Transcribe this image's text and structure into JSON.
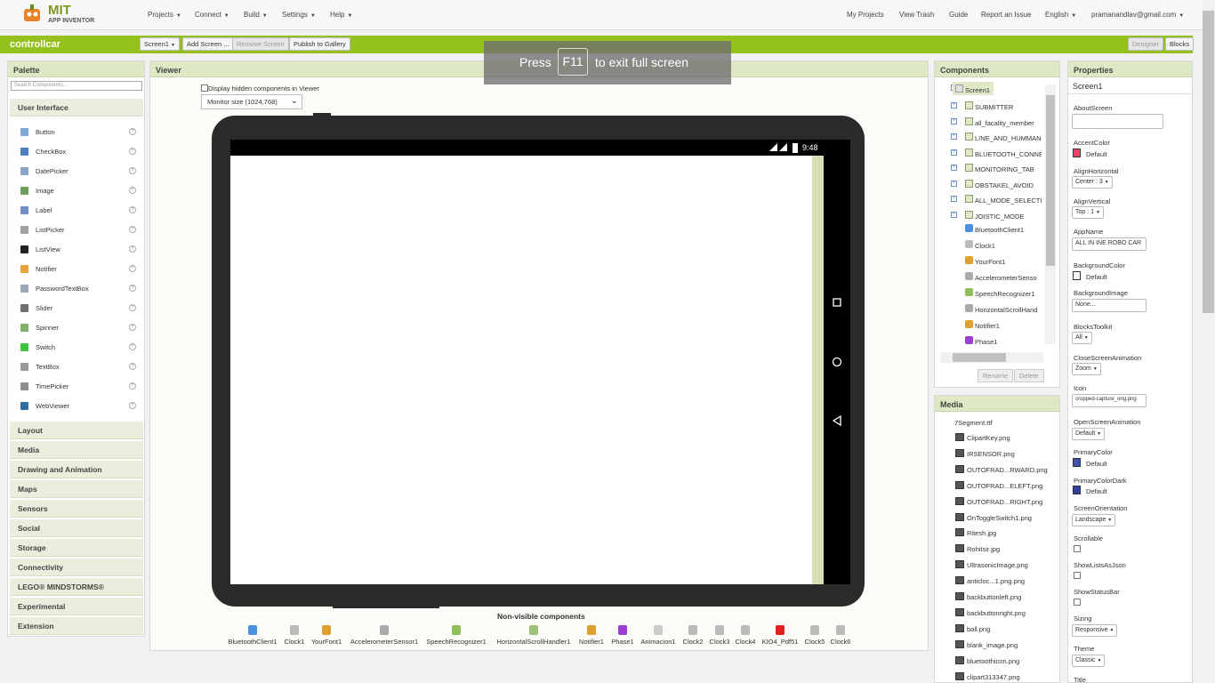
{
  "nav": {
    "logo_mit": "MIT",
    "logo_ai": "APP INVENTOR",
    "menus": [
      "Projects",
      "Connect",
      "Build",
      "Settings",
      "Help"
    ],
    "right_links": [
      "My Projects",
      "View Trash",
      "Guide",
      "Report an Issue"
    ],
    "language": "English",
    "account": "pramanandlav@gmail.com"
  },
  "project_bar": {
    "title": "controllcar",
    "screen_select": "Screen1",
    "add_screen": "Add Screen ...",
    "remove_screen": "Remove Screen",
    "publish": "Publish to Gallery",
    "designer": "Designer",
    "blocks": "Blocks"
  },
  "fullscreen_hint": {
    "press": "Press",
    "key": "F11",
    "rest": "to exit full screen"
  },
  "palette": {
    "title": "Palette",
    "search_placeholder": "Search Components...",
    "open_category": "User Interface",
    "items": [
      "Button",
      "CheckBox",
      "DatePicker",
      "Image",
      "Label",
      "ListPicker",
      "ListView",
      "Notifier",
      "PasswordTextBox",
      "Slider",
      "Spinner",
      "Switch",
      "TextBox",
      "TimePicker",
      "WebViewer"
    ],
    "categories": [
      "Layout",
      "Media",
      "Drawing and Animation",
      "Maps",
      "Sensors",
      "Social",
      "Storage",
      "Connectivity",
      "LEGO® MINDSTORMS®",
      "Experimental",
      "Extension"
    ]
  },
  "viewer": {
    "title": "Viewer",
    "hidden_label": "Display hidden components in Viewer",
    "size_select": "Monitor size (1024,768)",
    "status_time": "9:48",
    "nonvisible_title": "Non-visible components",
    "nonvisible": [
      "BluetoothClient1",
      "Clock1",
      "YourFont1",
      "AccelerometerSensor1",
      "SpeechRecognizer1",
      "HorizontalScrollHandler1",
      "Notifier1",
      "Phase1",
      "Animacion1",
      "Clock2",
      "Clock3",
      "Clock4",
      "KIO4_Pdf51",
      "Clock5",
      "Clock6"
    ]
  },
  "components": {
    "title": "Components",
    "root": "Screen1",
    "arrangements": [
      "SUBMITTER",
      "all_facality_member",
      "LINE_AND_HUMMAN",
      "BLUETOOTH_CONNE",
      "MONITORING_TAB",
      "OBSTAKEL_AVOID",
      "ALL_MODE_SELECTI",
      "JOISTIC_MODE"
    ],
    "others": [
      "BluetoothClient1",
      "Clock1",
      "YourFont1",
      "AccelerometerSenso",
      "SpeechRecognizer1",
      "HorizontalScrollHand",
      "Notifier1",
      "Phase1"
    ],
    "rename": "Rename",
    "delete": "Delete"
  },
  "media": {
    "title": "Media",
    "font_file": "7Segment.ttf",
    "files": [
      "ClipartKey.png",
      "IRSENSOR.png",
      "OUTOFRAD...RWARD.png",
      "OUTOFRAD...ELEFT.png",
      "OUTOFRAD...RIGHT.png",
      "OnToggleSwitch1.png",
      "Ritesh.jpg",
      "Rohitsir.jpg",
      "UltrasonicImage.png",
      "anticloc...1.png.png",
      "backbuttonleft.png",
      "backbuttonright.png",
      "ball.png",
      "blank_image.png",
      "bluetoothicon.png",
      "clipart313347.png"
    ]
  },
  "properties": {
    "title": "Properties",
    "component": "Screen1",
    "about_label": "AboutScreen",
    "accent_label": "AccentColor",
    "accent_value": "Default",
    "accent_color": "#e8456b",
    "alignh_label": "AlignHorizontal",
    "alignh_value": "Center : 3",
    "alignv_label": "AlignVertical",
    "alignv_value": "Top : 1",
    "appname_label": "AppName",
    "appname_value": "ALL IN INE ROBO CAR",
    "bg_label": "BackgroundColor",
    "bg_value": "Default",
    "bg_color": "#ffffff",
    "bgimg_label": "BackgroundImage",
    "bgimg_value": "None...",
    "toolkit_label": "BlocksToolkit",
    "toolkit_value": "All",
    "close_anim_label": "CloseScreenAnimation",
    "close_anim_value": "Zoom",
    "icon_label": "Icon",
    "icon_value": "cropped-capture_orig.png",
    "open_anim_label": "OpenScreenAnimation",
    "open_anim_value": "Default",
    "primary_label": "PrimaryColor",
    "primary_value": "Default",
    "primary_color": "#3f51b5",
    "primary_dark_label": "PrimaryColorDark",
    "primary_dark_value": "Default",
    "primary_dark_color": "#303f9f",
    "orientation_label": "ScreenOrientation",
    "orientation_value": "Landscape",
    "scrollable_label": "Scrollable",
    "showlists_label": "ShowListsAsJson",
    "statusbar_label": "ShowStatusBar",
    "sizing_label": "Sizing",
    "sizing_value": "Responsive",
    "theme_label": "Theme",
    "theme_value": "Classic",
    "title_label": "Title"
  }
}
